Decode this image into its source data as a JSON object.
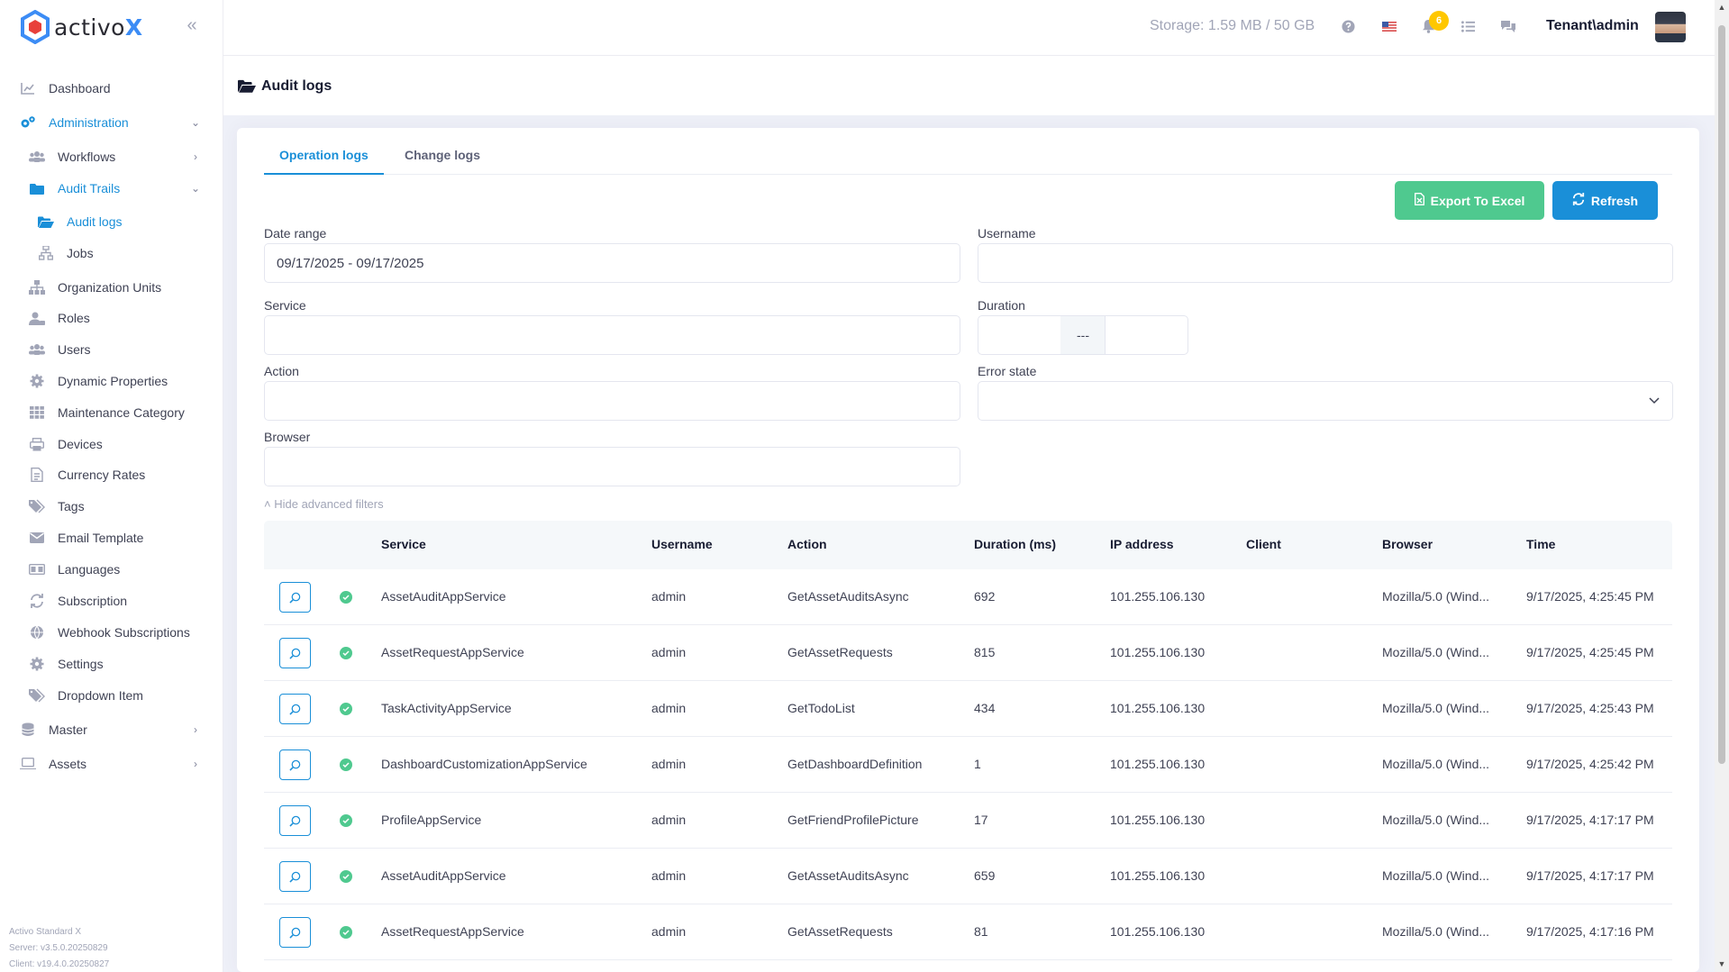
{
  "brand": {
    "name_prefix": "activo",
    "name_suffix": "X"
  },
  "header": {
    "storage": "Storage: 1.59 MB / 50 GB",
    "notification_count": "6",
    "user": "Tenant\\admin"
  },
  "sidebar": {
    "items": [
      {
        "label": "Dashboard"
      },
      {
        "label": "Administration"
      },
      {
        "label": "Workflows"
      },
      {
        "label": "Audit Trails"
      },
      {
        "label": "Audit logs"
      },
      {
        "label": "Jobs"
      },
      {
        "label": "Organization Units"
      },
      {
        "label": "Roles"
      },
      {
        "label": "Users"
      },
      {
        "label": "Dynamic Properties"
      },
      {
        "label": "Maintenance Category"
      },
      {
        "label": "Devices"
      },
      {
        "label": "Currency Rates"
      },
      {
        "label": "Tags"
      },
      {
        "label": "Email Template"
      },
      {
        "label": "Languages"
      },
      {
        "label": "Subscription"
      },
      {
        "label": "Webhook Subscriptions"
      },
      {
        "label": "Settings"
      },
      {
        "label": "Dropdown Item"
      },
      {
        "label": "Master"
      },
      {
        "label": "Assets"
      }
    ],
    "version": {
      "product": "Activo Standard X",
      "server": "Server: v3.5.0.20250829",
      "client": "Client: v19.4.0.20250827"
    }
  },
  "page": {
    "title": "Audit logs"
  },
  "tabs": {
    "operation": "Operation logs",
    "change": "Change logs"
  },
  "actions": {
    "export": "Export To Excel",
    "refresh": "Refresh"
  },
  "filters": {
    "date_range_label": "Date range",
    "date_range_value": "09/17/2025 - 09/17/2025",
    "username_label": "Username",
    "service_label": "Service",
    "duration_label": "Duration",
    "duration_separator": "---",
    "action_label": "Action",
    "error_state_label": "Error state",
    "browser_label": "Browser",
    "hide_advanced": "Hide advanced filters"
  },
  "table": {
    "headers": [
      "Service",
      "Username",
      "Action",
      "Duration (ms)",
      "IP address",
      "Client",
      "Browser",
      "Time"
    ],
    "rows": [
      {
        "service": "AssetAuditAppService",
        "username": "admin",
        "action": "GetAssetAuditsAsync",
        "duration": "692",
        "ip": "101.255.106.130",
        "client": "",
        "browser": "Mozilla/5.0 (Wind...",
        "time": "9/17/2025, 4:25:45 PM"
      },
      {
        "service": "AssetRequestAppService",
        "username": "admin",
        "action": "GetAssetRequests",
        "duration": "815",
        "ip": "101.255.106.130",
        "client": "",
        "browser": "Mozilla/5.0 (Wind...",
        "time": "9/17/2025, 4:25:45 PM"
      },
      {
        "service": "TaskActivityAppService",
        "username": "admin",
        "action": "GetTodoList",
        "duration": "434",
        "ip": "101.255.106.130",
        "client": "",
        "browser": "Mozilla/5.0 (Wind...",
        "time": "9/17/2025, 4:25:43 PM"
      },
      {
        "service": "DashboardCustomizationAppService",
        "username": "admin",
        "action": "GetDashboardDefinition",
        "duration": "1",
        "ip": "101.255.106.130",
        "client": "",
        "browser": "Mozilla/5.0 (Wind...",
        "time": "9/17/2025, 4:25:42 PM"
      },
      {
        "service": "ProfileAppService",
        "username": "admin",
        "action": "GetFriendProfilePicture",
        "duration": "17",
        "ip": "101.255.106.130",
        "client": "",
        "browser": "Mozilla/5.0 (Wind...",
        "time": "9/17/2025, 4:17:17 PM"
      },
      {
        "service": "AssetAuditAppService",
        "username": "admin",
        "action": "GetAssetAuditsAsync",
        "duration": "659",
        "ip": "101.255.106.130",
        "client": "",
        "browser": "Mozilla/5.0 (Wind...",
        "time": "9/17/2025, 4:17:17 PM"
      },
      {
        "service": "AssetRequestAppService",
        "username": "admin",
        "action": "GetAssetRequests",
        "duration": "81",
        "ip": "101.255.106.130",
        "client": "",
        "browser": "Mozilla/5.0 (Wind...",
        "time": "9/17/2025, 4:17:16 PM"
      }
    ]
  },
  "colors": {
    "accent": "#1a8fd8",
    "success": "#4fc98f",
    "badge": "#ffc700"
  }
}
